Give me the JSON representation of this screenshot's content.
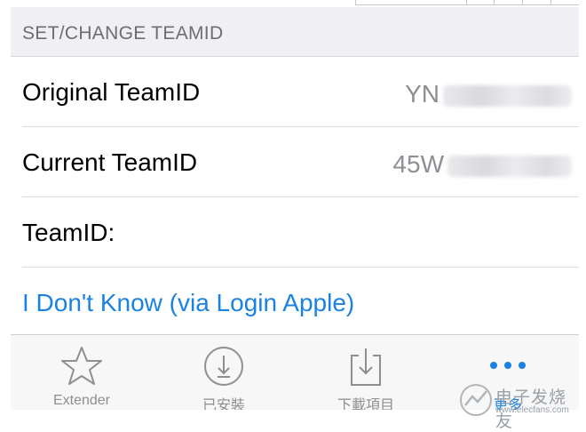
{
  "section": {
    "header": "SET/CHANGE TEAMID"
  },
  "rows": [
    {
      "label": "Original TeamID",
      "value": "YN"
    },
    {
      "label": "Current TeamID",
      "value": "45W"
    },
    {
      "label": "TeamID:",
      "value": ""
    }
  ],
  "link": {
    "label": "I Don't Know (via Login Apple)"
  },
  "tabbar": {
    "tabs": [
      {
        "label": "Extender",
        "icon": "star-icon"
      },
      {
        "label": "已安裝",
        "icon": "download-circle-icon"
      },
      {
        "label": "下載項目",
        "icon": "download-tray-icon"
      },
      {
        "label": "更多",
        "icon": "more-icon"
      }
    ],
    "active_index": 3
  },
  "watermark": {
    "text": "电子发烧友",
    "url": "www.elecfans.com"
  },
  "colors": {
    "accent": "#1a82e2",
    "header_bg": "#efeff4",
    "secondary_text": "#8e8e93"
  }
}
